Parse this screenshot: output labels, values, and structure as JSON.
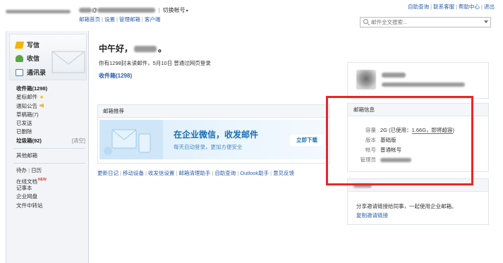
{
  "topbar": {
    "user_suffix": "@",
    "switch_account": "切换帐号",
    "links": [
      "邮箱首页",
      "设置",
      "管理邮箱",
      "客户端"
    ],
    "right_links": [
      "自助查询",
      "联系客服",
      "帮助中心",
      "退出"
    ],
    "search_placeholder": "邮件全文搜索..."
  },
  "sidebar": {
    "quick": {
      "write": "写信",
      "inbox": "收信",
      "contacts": "通讯录"
    },
    "folders": [
      {
        "label": "收件箱(1298)",
        "bold": true
      },
      {
        "label": "星标邮件",
        "badge": "★"
      },
      {
        "label": "通知公告"
      },
      {
        "label": "草稿箱(7)"
      },
      {
        "label": "已发送"
      },
      {
        "label": "已删除"
      },
      {
        "label": "垃圾箱(92)",
        "bold": true,
        "action": "[清空]"
      }
    ],
    "other_mailbox": "其他邮箱",
    "tools": {
      "todo": "待办",
      "calendar": "日历",
      "doc": "在线文档",
      "new_badge": "NEW",
      "notes": "记事本",
      "drive": "企业网盘",
      "transfer": "文件中转站"
    }
  },
  "main": {
    "greeting_prefix": "中午好，",
    "greeting_suffix": "。",
    "summary": "你有1298封未读邮件，5月10日 曾通过网页登录",
    "inbox_link": "收件箱(1298)",
    "promo": {
      "header": "邮箱推荐",
      "title": "在企业微信，收发邮件",
      "subtitle": "每天自动登录，更加方便安全",
      "button": "立即下载"
    },
    "bottom_links": [
      "更新日记",
      "移动设备",
      "收发信设置",
      "邮箱清理助手",
      "自助查询",
      "Outlook助手",
      "意见反馈"
    ]
  },
  "info": {
    "header": "邮箱信息",
    "capacity_label": "容量",
    "capacity_prefix": "2G (已使用：",
    "capacity_used": "1.66G，即将超容",
    "capacity_suffix": ")",
    "version_label": "版本",
    "version_value": "基础版",
    "account_label": "帐号",
    "account_value": "普通帐号",
    "admin_label": "管理员"
  },
  "invite": {
    "desc": "分享邀请链接给同事，一起使用企业邮箱。",
    "link": "复制邀请链接"
  },
  "colors": {
    "highlight": "#e8262a",
    "link": "#2a5db0",
    "promo_title": "#1a6fb4"
  }
}
